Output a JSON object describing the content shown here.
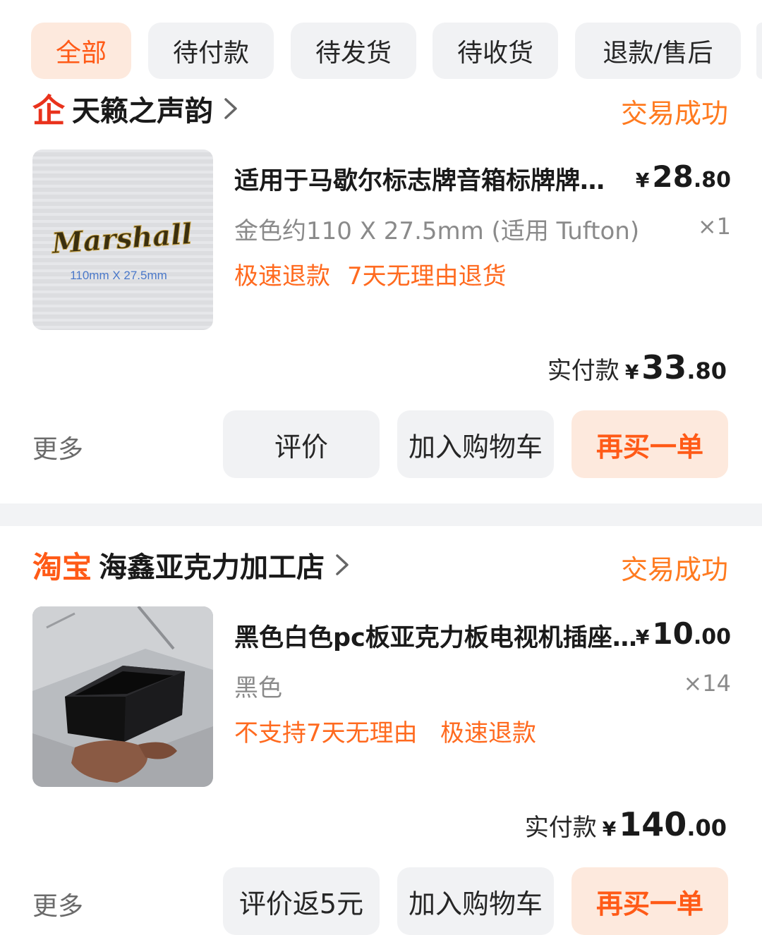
{
  "tabs": [
    {
      "label": "全部",
      "active": true
    },
    {
      "label": "待付款",
      "active": false
    },
    {
      "label": "待发货",
      "active": false
    },
    {
      "label": "待收货",
      "active": false
    },
    {
      "label": "退款/售后",
      "active": false
    }
  ],
  "orders": [
    {
      "store_logo": "企",
      "store_logo_icon": "enterprise-store-icon",
      "store_name": "天籁之声韵",
      "status": "交易成功",
      "product": {
        "title": "适用于马歇尔标志牌音箱标牌牌贴金属标志牌",
        "price_currency": "¥",
        "price_int": "28",
        "price_dec": ".80",
        "spec": "金色约110 X 27.5mm (适用 Tufton)",
        "quantity": "×1",
        "tags": [
          "极速退款",
          "7天无理由退货"
        ],
        "thumb_text": "Marshall",
        "thumb_caption": "110mm X 27.5mm"
      },
      "paid_label": "实付款",
      "paid_currency": "¥",
      "paid_int": "33",
      "paid_dec": ".80",
      "more_label": "更多",
      "buttons": [
        "评价",
        "加入购物车",
        "再买一单"
      ]
    },
    {
      "store_logo": "淘宝",
      "store_logo_icon": "taobao-logo-icon",
      "store_name": "海鑫亚克力加工店",
      "status": "交易成功",
      "product": {
        "title": "黑色白色pc板亚克力板电视机插座盒子定做",
        "price_currency": "¥",
        "price_int": "10",
        "price_dec": ".00",
        "spec": "黑色",
        "quantity": "×14",
        "tags": [
          "不支持7天无理由",
          "极速退款"
        ]
      },
      "paid_label": "实付款",
      "paid_currency": "¥",
      "paid_int": "140",
      "paid_dec": ".00",
      "more_label": "更多",
      "buttons": [
        "评价返5元",
        "加入购物车",
        "再买一单"
      ]
    }
  ],
  "colors": {
    "accent": "#ff5a17",
    "status": "#ff7a1f",
    "button_bg": "#f1f2f4",
    "primary_button_bg": "#fde9dd"
  }
}
